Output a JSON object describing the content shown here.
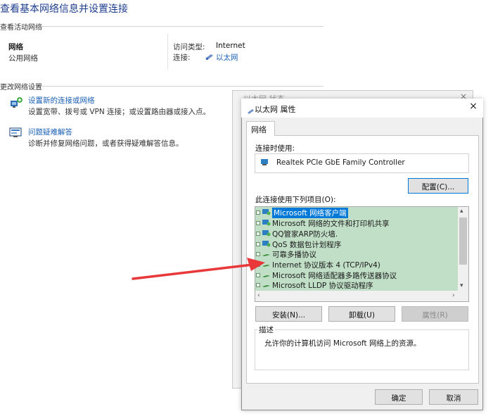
{
  "page": {
    "title": "查看基本网络信息并设置连接",
    "active_networks_heading": "查看活动网络",
    "network_name": "网络",
    "network_type": "公用网络",
    "access_type_label": "访问类型:",
    "access_type_value": "Internet",
    "connection_label": "连接:",
    "connection_value": "以太网",
    "change_settings_heading": "更改网络设置",
    "tasks": [
      {
        "link": "设置新的连接或网络",
        "description": "设置宽带、拨号或 VPN 连接；或设置路由器或接入点。",
        "icon": "new-connection-icon"
      },
      {
        "link": "问题疑难解答",
        "description": "诊断并修复网络问题，或者获得疑难解答信息。",
        "icon": "troubleshoot-icon"
      }
    ]
  },
  "status_dialog": {
    "title": "以太网 状态",
    "close": "×"
  },
  "properties_dialog": {
    "title": "以太网 属性",
    "close": "×",
    "tab": "网络",
    "connect_using_label": "连接时使用:",
    "adapter": "Realtek PCIe GbE Family Controller",
    "configure_button": "配置(C)...",
    "items_label": "此连接使用下列项目(O):",
    "items": [
      {
        "label": "Microsoft 网络客户端",
        "icon": "client-icon",
        "selected": true
      },
      {
        "label": "Microsoft 网络的文件和打印机共享",
        "icon": "service-icon",
        "selected": false
      },
      {
        "label": "QQ管家ARP防火墙.",
        "icon": "service-icon",
        "selected": false
      },
      {
        "label": "QoS 数据包计划程序",
        "icon": "service-icon",
        "selected": false
      },
      {
        "label": "可靠多播协议",
        "icon": "protocol-icon",
        "selected": false
      },
      {
        "label": "Internet 协议版本 4 (TCP/IPv4)",
        "icon": "protocol-icon",
        "selected": false
      },
      {
        "label": "Microsoft 网络适配器多路传送器协议",
        "icon": "protocol-icon",
        "selected": false
      },
      {
        "label": "Microsoft LLDP 协议驱动程序",
        "icon": "protocol-icon",
        "selected": false
      }
    ],
    "install_button": "安装(N)...",
    "uninstall_button": "卸载(U)",
    "properties_button": "属性(R)",
    "description_label": "描述",
    "description_text": "允许你的计算机访问 Microsoft 网络上的资源。",
    "ok_button": "确定",
    "cancel_button": "取消"
  },
  "colors": {
    "accent": "#0078d7",
    "link": "#1a5fb4",
    "list_highlight": "#c1dfc7",
    "annotation_arrow": "#e8383a"
  }
}
